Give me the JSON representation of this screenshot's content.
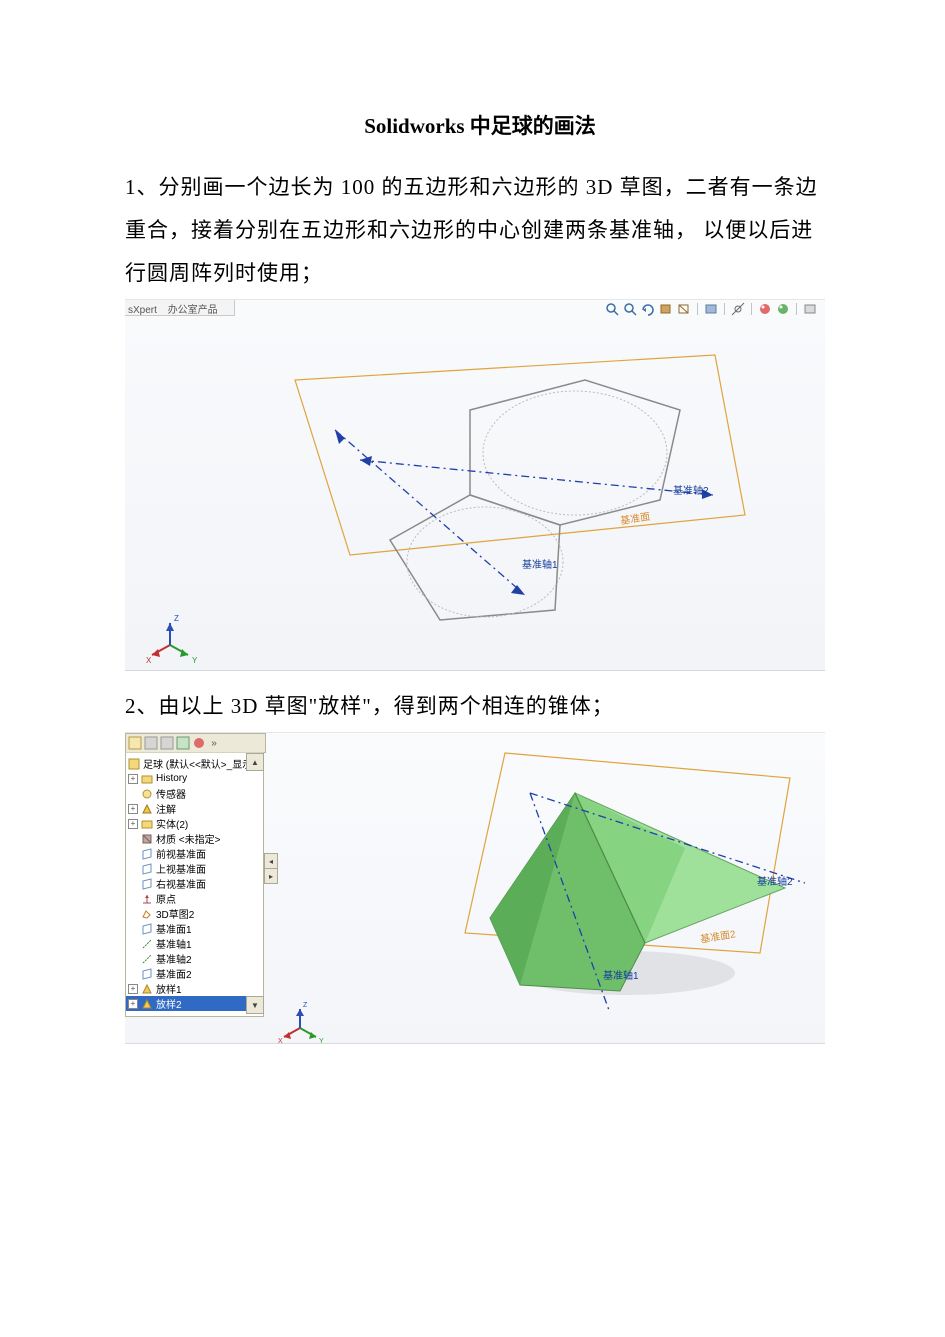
{
  "title": "Solidworks 中足球的画法",
  "paragraph1": "1、分别画一个边长为 100 的五边形和六边形的 3D 草图，二者有一条边重合，接着分别在五边形和六边形的中心创建两条基准轴， 以便以后进行圆周阵列时使用；",
  "paragraph2": "2、由以上 3D 草图\"放样\"，得到两个相连的锥体；",
  "fig1": {
    "tab_left": "sXpert",
    "tab_right": "办公室产品",
    "axis1": "基准轴1",
    "axis2": "基准轴2",
    "plane": "基准面",
    "triad": {
      "x": "X",
      "y": "Y",
      "z": "Z"
    }
  },
  "fig2": {
    "root": "足球 (默认<<默认>_显示状…",
    "history": "History",
    "sensor": "传感器",
    "anno": "注解",
    "body": "实体(2)",
    "material": "材质 <未指定>",
    "front": "前视基准面",
    "top": "上视基准面",
    "right": "右视基准面",
    "origin": "原点",
    "sketch3d": "3D草图2",
    "plane1": "基准面1",
    "axis1": "基准轴1",
    "axis2": "基准轴2",
    "plane2": "基准面2",
    "loft1": "放样1",
    "loft2": "放样2",
    "lbl_axis1": "基准轴1",
    "lbl_axis2": "基准轴2",
    "lbl_plane": "基准面2",
    "triad": {
      "x": "X",
      "y": "Y",
      "z": "Z"
    }
  }
}
